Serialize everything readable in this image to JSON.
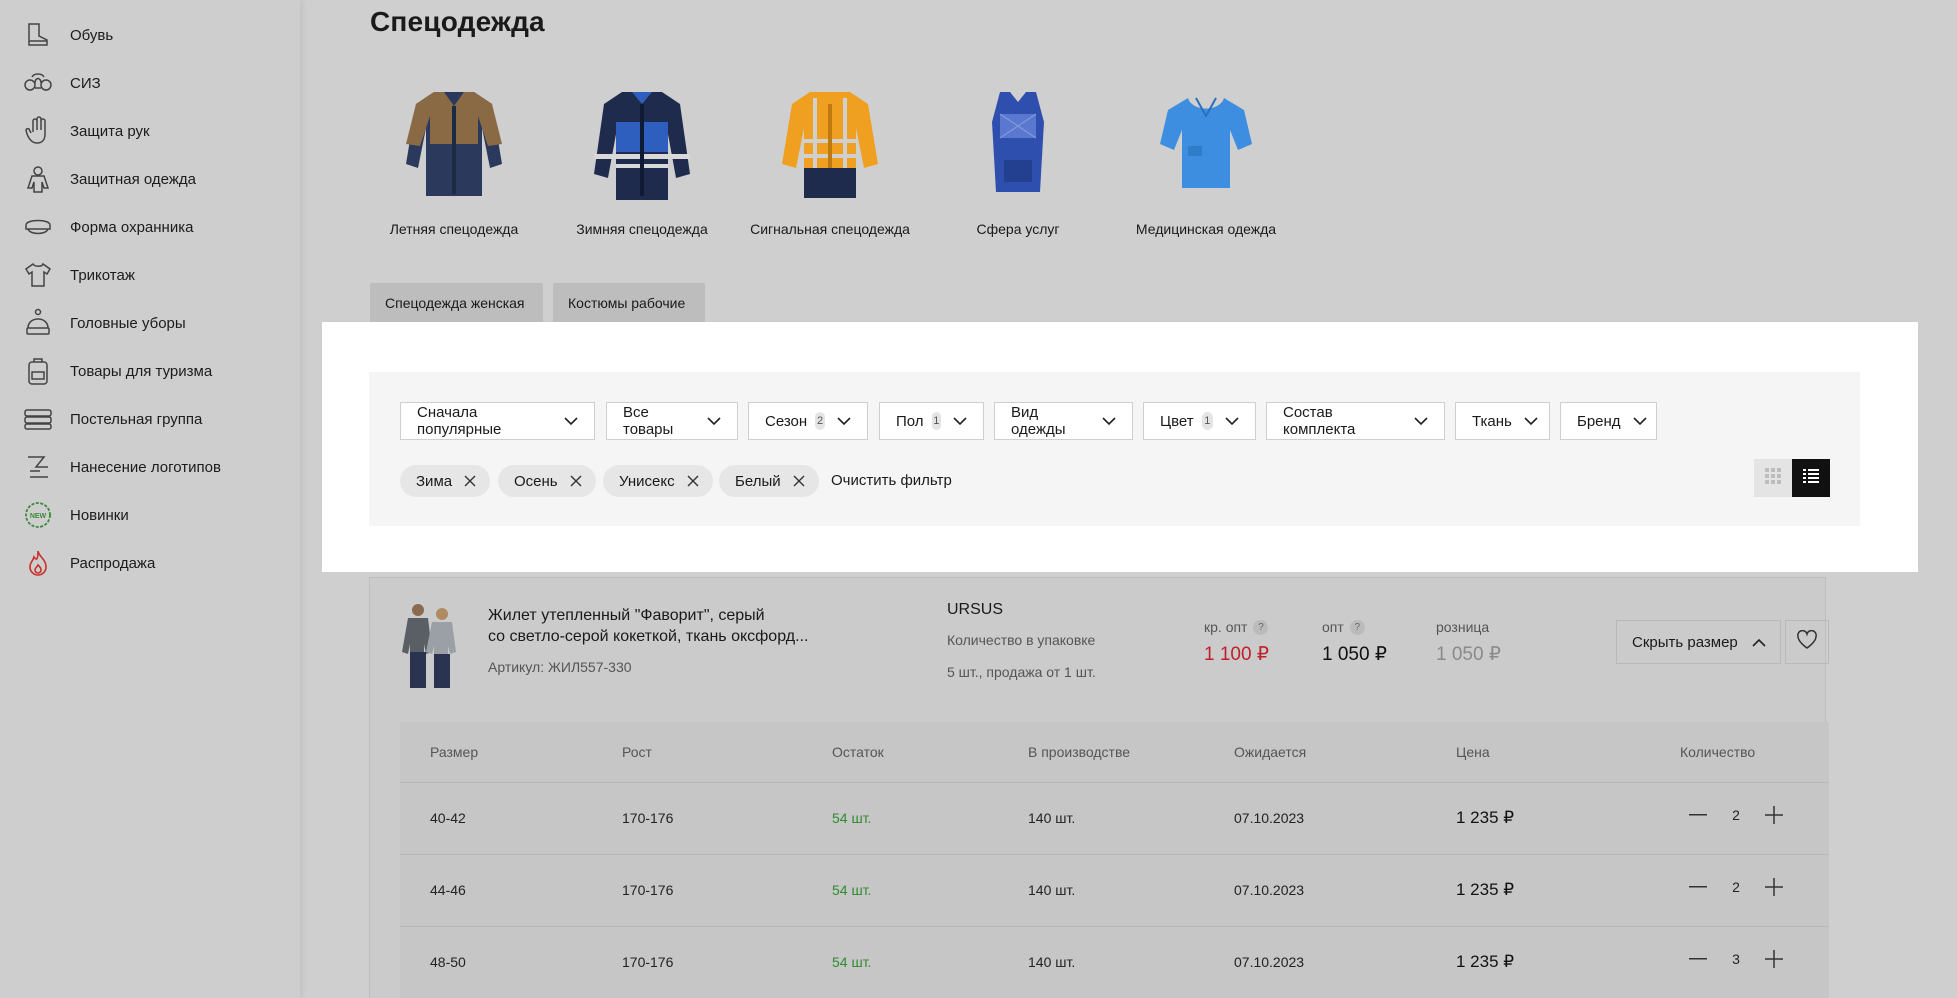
{
  "sidebar": {
    "items": [
      {
        "label": "Обувь",
        "icon": "boot-icon"
      },
      {
        "label": "СИЗ",
        "icon": "respirator-icon"
      },
      {
        "label": "Защита рук",
        "icon": "glove-icon"
      },
      {
        "label": "Защитная одежда",
        "icon": "protective-suit-icon"
      },
      {
        "label": "Форма охранника",
        "icon": "guard-cap-icon"
      },
      {
        "label": "Трикотаж",
        "icon": "tshirt-icon"
      },
      {
        "label": "Головные уборы",
        "icon": "beanie-icon"
      },
      {
        "label": "Товары для туризма",
        "icon": "backpack-icon"
      },
      {
        "label": "Постельная группа",
        "icon": "bedding-icon"
      },
      {
        "label": "Нанесение логотипов",
        "icon": "print-icon"
      },
      {
        "label": "Новинки",
        "icon": "new-badge-icon",
        "badge_text": "NEW"
      },
      {
        "label": "Распродажа",
        "icon": "fire-icon"
      }
    ]
  },
  "page": {
    "title": "Спецодежда"
  },
  "categories": [
    {
      "label": "Летняя спецодежда",
      "icon": "summer-jacket-icon"
    },
    {
      "label": "Зимняя спецодежда",
      "icon": "winter-jacket-icon"
    },
    {
      "label": "Сигнальная спецодежда",
      "icon": "signal-jacket-icon"
    },
    {
      "label": "Сфера услуг",
      "icon": "apron-icon"
    },
    {
      "label": "Медицинская одежда",
      "icon": "medical-shirt-icon"
    }
  ],
  "subcats": [
    "Спецодежда женская",
    "Костюмы рабочие"
  ],
  "filters": {
    "dropdowns": [
      {
        "label": "Сначала популярные",
        "badge": ""
      },
      {
        "label": "Все товары",
        "badge": ""
      },
      {
        "label": "Сезон",
        "badge": "2"
      },
      {
        "label": "Пол",
        "badge": "1"
      },
      {
        "label": "Вид одежды",
        "badge": ""
      },
      {
        "label": "Цвет",
        "badge": "1"
      },
      {
        "label": "Состав комплекта",
        "badge": ""
      },
      {
        "label": "Ткань",
        "badge": ""
      },
      {
        "label": "Бренд",
        "badge": ""
      }
    ],
    "active_tags": [
      "Зима",
      "Осень",
      "Унисекс",
      "Белый"
    ],
    "clear_label": "Очистить фильтр",
    "view_modes": [
      "grid-icon",
      "list-icon"
    ],
    "active_view": "list"
  },
  "product": {
    "name_line1": "Жилет утепленный \"Фаворит\", серый",
    "name_line2": "со светло-серой кокеткой, ткань оксфорд...",
    "article": "Артикул: ЖИЛ557-330",
    "brand": "URSUS",
    "pack_label": "Количество в упаковке",
    "pack_value": "5 шт., продажа от 1 шт.",
    "prices": [
      {
        "label": "кр. опт",
        "value": "1 100 ₽",
        "help": "?",
        "color": "#c0202a"
      },
      {
        "label": "опт",
        "value": "1 050 ₽",
        "help": "?",
        "color": "#111111"
      },
      {
        "label": "розница",
        "value": "1 050 ₽",
        "help": "",
        "color": "#8a8a8a"
      }
    ],
    "hide_size_label": "Скрыть размер"
  },
  "size_table": {
    "headers": [
      "Размер",
      "Рост",
      "Остаток",
      "В производстве",
      "Ожидается",
      "Цена",
      "Количество"
    ],
    "rows": [
      {
        "size": "40-42",
        "height": "170-176",
        "stock": "54 шт.",
        "production": "140 шт.",
        "expected": "07.10.2023",
        "price": "1 235 ₽",
        "qty": "2"
      },
      {
        "size": "44-46",
        "height": "170-176",
        "stock": "54 шт.",
        "production": "140 шт.",
        "expected": "07.10.2023",
        "price": "1 235 ₽",
        "qty": "2"
      },
      {
        "size": "48-50",
        "height": "170-176",
        "stock": "54 шт.",
        "production": "140 шт.",
        "expected": "07.10.2023",
        "price": "1 235 ₽",
        "qty": "3"
      }
    ]
  }
}
